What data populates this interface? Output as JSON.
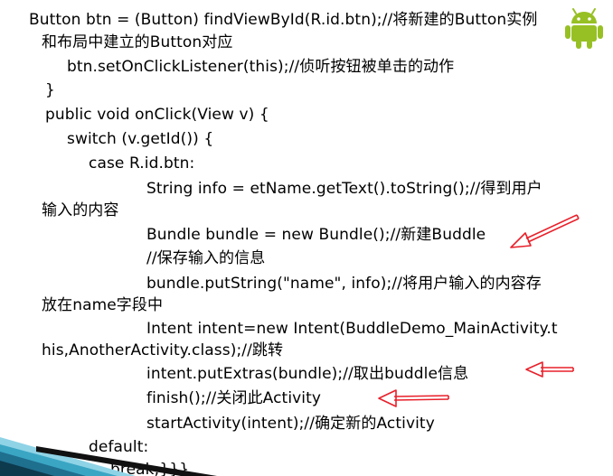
{
  "code": {
    "lines": [
      "Button btn = (Button) findViewById(R.id.btn);//将新建的Button实例",
      "和布局中建立的Button对应",
      "btn.setOnClickListener(this);//侦听按钮被单击的动作",
      "}",
      "public void onClick(View v) {",
      "switch (v.getId()) {",
      "case R.id.btn:",
      "String info = etName.getText().toString();//得到用户",
      "输入的内容",
      "Bundle bundle = new Bundle();//新建Buddle",
      "//保存输入的信息",
      "bundle.putString(\"name\", info);//将用户输入的内容存",
      "放在name字段中",
      "Intent intent=new Intent(BuddleDemo_MainActivity.t",
      "his,AnotherActivity.class);//跳转",
      "intent.putExtras(bundle);//取出buddle信息",
      "finish();//关闭此Activity",
      "startActivity(intent);//确定新的Activity",
      "default:",
      "break;}}}"
    ]
  },
  "colors": {
    "text": "#000000",
    "annotation_arrow": "#e8202a",
    "android_green": "#97c024",
    "background": "#ffffff"
  },
  "icons": {
    "android": "android-robot-icon",
    "arrow": "red-arrow-icon"
  }
}
